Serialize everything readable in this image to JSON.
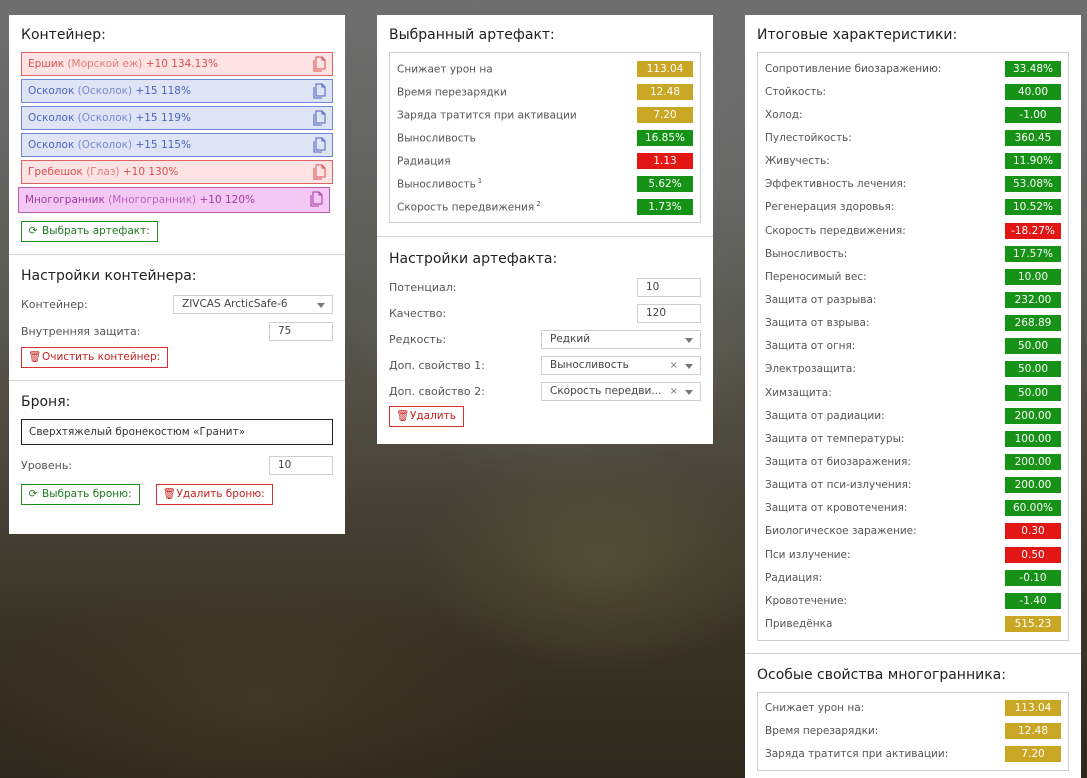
{
  "container": {
    "title": "Контейнер:",
    "items": [
      {
        "name": "Ершик",
        "type": "(Морской еж)",
        "stats": "+10 134.13%",
        "color": "pink"
      },
      {
        "name": "Осколок",
        "type": "(Осколок)",
        "stats": "+15 118%",
        "color": "blue"
      },
      {
        "name": "Осколок",
        "type": "(Осколок)",
        "stats": "+15 119%",
        "color": "blue"
      },
      {
        "name": "Осколок",
        "type": "(Осколок)",
        "stats": "+15 115%",
        "color": "blue"
      },
      {
        "name": "Гребешок",
        "type": "(Глаз)",
        "stats": "+10 130%",
        "color": "pink"
      },
      {
        "name": "Многогранник",
        "type": "(Многогранник)",
        "stats": "+10 120%",
        "color": "violet"
      }
    ],
    "select_button": "Выбрать артефакт:",
    "copy_icon": "copy-icon",
    "refresh_icon": "refresh-icon"
  },
  "container_settings": {
    "title": "Настройки контейнера:",
    "container_label": "Контейнер:",
    "container_value": "ZIVCAS ArcticSafe-6",
    "protection_label": "Внутренняя защита:",
    "protection_value": "75",
    "clear_button": "Очистить контейнер:",
    "trash_icon": "trash-icon"
  },
  "armor": {
    "title": "Броня:",
    "name": "Сверхтяжелый бронекостюм «Гранит»",
    "level_label": "Уровень:",
    "level_value": "10",
    "select_button": "Выбрать броню:",
    "delete_button": "Удалить броню:"
  },
  "selected_artifact": {
    "title": "Выбранный артефакт:",
    "stats": [
      {
        "label": "Снижает урон на",
        "sup": "",
        "value": "113.04",
        "color": "gold"
      },
      {
        "label": "Время перезарядки",
        "sup": "",
        "value": "12.48",
        "color": "gold"
      },
      {
        "label": "Заряда тратится при активации",
        "sup": "",
        "value": "7.20",
        "color": "gold"
      },
      {
        "label": "Выносливость",
        "sup": "",
        "value": "16.85%",
        "color": "green"
      },
      {
        "label": "Радиация",
        "sup": "",
        "value": "1.13",
        "color": "red"
      },
      {
        "label": "Выносливость",
        "sup": "1",
        "value": "5.62%",
        "color": "green"
      },
      {
        "label": "Скорость передвижения",
        "sup": "2",
        "value": "1.73%",
        "color": "green"
      }
    ]
  },
  "artifact_settings": {
    "title": "Настройки артефакта:",
    "potential_label": "Потенциал:",
    "potential_value": "10",
    "quality_label": "Качество:",
    "quality_value": "120",
    "rarity_label": "Редкость:",
    "rarity_value": "Редкий",
    "extra1_label": "Доп. свойство 1:",
    "extra1_value": "Выносливость",
    "extra2_label": "Доп. свойство 2:",
    "extra2_value": "Скорость передви...",
    "clear_glyph": "×",
    "delete_button": "Удалить"
  },
  "totals": {
    "title": "Итоговые характеристики:",
    "stats": [
      {
        "label": "Сопротивление биозаражению:",
        "value": "33.48%",
        "color": "green"
      },
      {
        "label": "Стойкость:",
        "value": "40.00",
        "color": "green"
      },
      {
        "label": "Холод:",
        "value": "-1.00",
        "color": "green"
      },
      {
        "label": "Пулестойкость:",
        "value": "360.45",
        "color": "green"
      },
      {
        "label": "Живучесть:",
        "value": "11.90%",
        "color": "green"
      },
      {
        "label": "Эффективность лечения:",
        "value": "53.08%",
        "color": "green"
      },
      {
        "label": "Регенерация здоровья:",
        "value": "10.52%",
        "color": "green"
      },
      {
        "label": "Скорость передвижения:",
        "value": "-18.27%",
        "color": "red"
      },
      {
        "label": "Выносливость:",
        "value": "17.57%",
        "color": "green"
      },
      {
        "label": "Переносимый вес:",
        "value": "10.00",
        "color": "green"
      },
      {
        "label": "Защита от разрыва:",
        "value": "232.00",
        "color": "green"
      },
      {
        "label": "Защита от взрыва:",
        "value": "268.89",
        "color": "green"
      },
      {
        "label": "Защита от огня:",
        "value": "50.00",
        "color": "green"
      },
      {
        "label": "Электрозащита:",
        "value": "50.00",
        "color": "green"
      },
      {
        "label": "Химзащита:",
        "value": "50.00",
        "color": "green"
      },
      {
        "label": "Защита от радиации:",
        "value": "200.00",
        "color": "green"
      },
      {
        "label": "Защита от температуры:",
        "value": "100.00",
        "color": "green"
      },
      {
        "label": "Защита от биозаражения:",
        "value": "200.00",
        "color": "green"
      },
      {
        "label": "Защита от пси-излучения:",
        "value": "200.00",
        "color": "green"
      },
      {
        "label": "Защита от кровотечения:",
        "value": "60.00%",
        "color": "green"
      },
      {
        "label": "Биологическое заражение:",
        "value": "0.30",
        "color": "red"
      },
      {
        "label": "Пси излучение:",
        "value": "0.50",
        "color": "red"
      },
      {
        "label": "Радиация:",
        "value": "-0.10",
        "color": "green"
      },
      {
        "label": "Кровотечение:",
        "value": "-1.40",
        "color": "green"
      },
      {
        "label": "Приведёнка",
        "value": "515.23",
        "color": "gold"
      }
    ]
  },
  "special": {
    "title": "Особые свойства многогранника:",
    "stats": [
      {
        "label": "Снижает урон на:",
        "value": "113.04",
        "color": "gold"
      },
      {
        "label": "Время перезарядки:",
        "value": "12.48",
        "color": "gold"
      },
      {
        "label": "Заряда тратится при активации:",
        "value": "7.20",
        "color": "gold"
      }
    ]
  },
  "colors": {
    "gold": "#c9a624",
    "green": "#169216",
    "red": "#e31616"
  }
}
